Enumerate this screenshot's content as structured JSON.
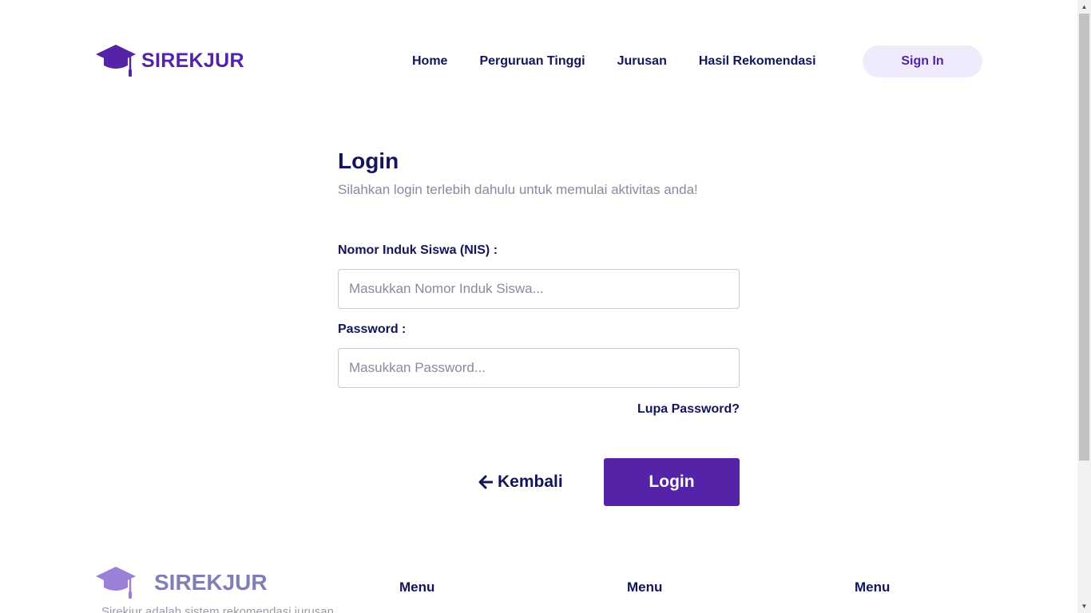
{
  "header": {
    "brand_name": "SIREKJUR",
    "nav": [
      {
        "label": "Home"
      },
      {
        "label": "Perguruan Tinggi"
      },
      {
        "label": "Jurusan"
      },
      {
        "label": "Hasil Rekomendasi"
      }
    ],
    "signin_label": "Sign In"
  },
  "login": {
    "title": "Login",
    "subtitle": "Silahkan login terlebih dahulu untuk memulai aktivitas anda!",
    "nis_label": "Nomor Induk Siswa (NIS) :",
    "nis_placeholder": "Masukkan Nomor Induk Siswa...",
    "nis_value": "",
    "password_label": "Password :",
    "password_placeholder": "Masukkan Password...",
    "password_value": "",
    "forgot_label": "Lupa Password?",
    "back_label": "Kembali",
    "submit_label": "Login"
  },
  "footer": {
    "brand_name": "SIREKJUR",
    "description": "Sirekjur adalah sistem rekomendasi jurusan",
    "columns": [
      {
        "title": "Menu"
      },
      {
        "title": "Menu"
      },
      {
        "title": "Menu"
      }
    ]
  },
  "colors": {
    "brand": "#5523a7",
    "text_dark": "#14145c",
    "muted": "#8a8a9c",
    "signin_bg": "#f0ebfc",
    "footer_brand": "#7f7fb3"
  },
  "icons": {
    "logo": "graduation-cap-icon",
    "back": "arrow-left-icon"
  }
}
